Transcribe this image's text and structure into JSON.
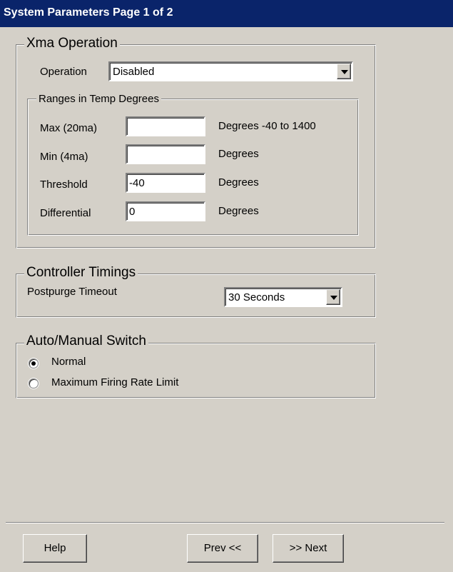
{
  "window": {
    "title": "System Parameters Page 1 of 2"
  },
  "xma_operation": {
    "group_label": "Xma Operation",
    "operation_label": "Operation",
    "operation_value": "Disabled",
    "ranges": {
      "group_label": "Ranges in Temp Degrees",
      "max_label": "Max (20ma)",
      "max_value": "",
      "max_units": "Degrees  -40 to 1400",
      "min_label": "Min (4ma)",
      "min_value": "",
      "min_units": "Degrees",
      "threshold_label": "Threshold",
      "threshold_value": "-40",
      "threshold_units": "Degrees",
      "differential_label": "Differential",
      "differential_value": "0",
      "differential_units": "Degrees"
    }
  },
  "controller_timings": {
    "group_label": "Controller Timings",
    "postpurge_label": "Postpurge Timeout",
    "postpurge_value": "30 Seconds"
  },
  "auto_manual": {
    "group_label": "Auto/Manual Switch",
    "options": [
      {
        "label": "Normal",
        "selected": true
      },
      {
        "label": "Maximum Firing Rate Limit",
        "selected": false
      }
    ]
  },
  "buttons": {
    "help": "Help",
    "prev": "Prev <<",
    "next": ">> Next"
  }
}
